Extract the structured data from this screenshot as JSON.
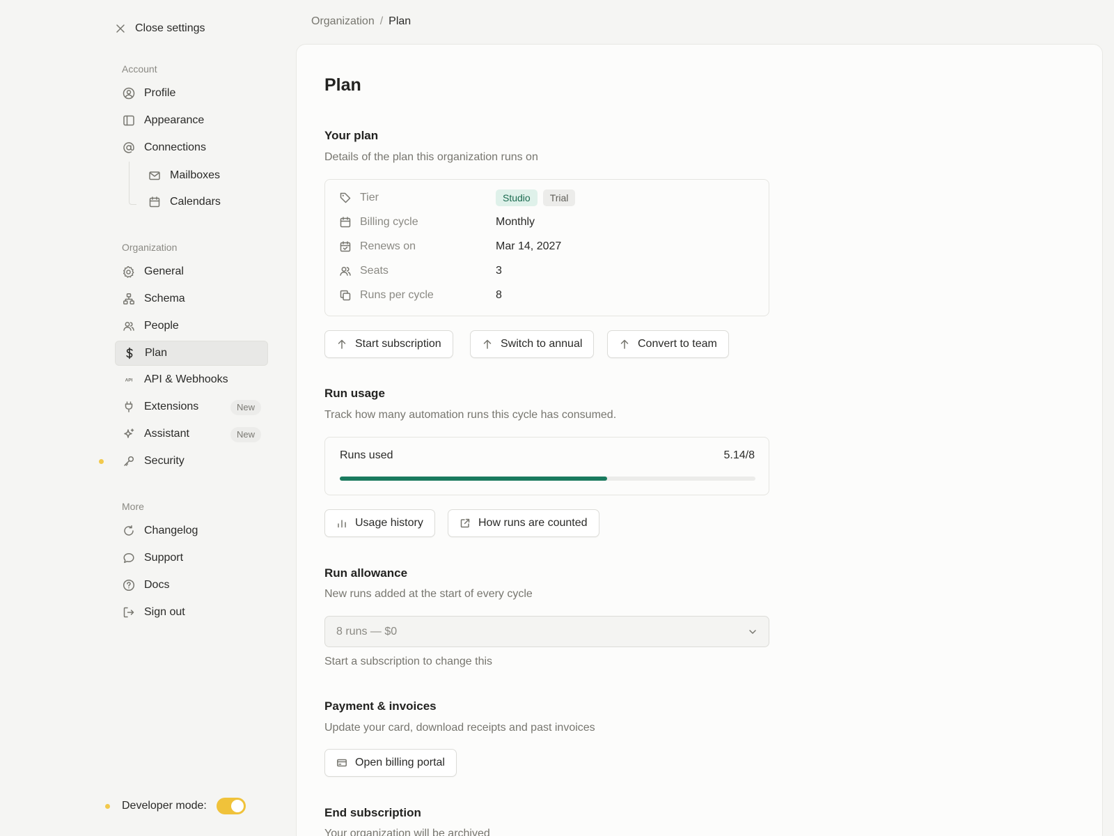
{
  "sidebar": {
    "close_label": "Close settings",
    "sections": {
      "account": "Account",
      "organization": "Organization",
      "more": "More"
    },
    "account_items": [
      {
        "label": "Profile",
        "icon": "user-circle-icon"
      },
      {
        "label": "Appearance",
        "icon": "layout-icon"
      },
      {
        "label": "Connections",
        "icon": "at-sign-icon"
      },
      {
        "label": "Mailboxes",
        "icon": "mail-icon"
      },
      {
        "label": "Calendars",
        "icon": "calendar-icon"
      }
    ],
    "org_items": [
      {
        "label": "General",
        "icon": "gear-icon"
      },
      {
        "label": "Schema",
        "icon": "schema-icon"
      },
      {
        "label": "People",
        "icon": "users-icon"
      },
      {
        "label": "Plan",
        "icon": "dollar-icon",
        "active": true
      },
      {
        "label": "API & Webhooks",
        "icon": "api-icon"
      },
      {
        "label": "Extensions",
        "icon": "plug-icon",
        "badge": "New"
      },
      {
        "label": "Assistant",
        "icon": "sparkle-icon",
        "badge": "New"
      },
      {
        "label": "Security",
        "icon": "key-icon"
      }
    ],
    "more_items": [
      {
        "label": "Changelog",
        "icon": "refresh-icon"
      },
      {
        "label": "Support",
        "icon": "chat-icon"
      },
      {
        "label": "Docs",
        "icon": "help-circle-icon"
      },
      {
        "label": "Sign out",
        "icon": "logout-icon"
      }
    ],
    "developer_mode_label": "Developer mode:",
    "developer_mode_on": true,
    "accent_color": "#f0c23a"
  },
  "breadcrumb": {
    "parent": "Organization",
    "separator": "/",
    "current": "Plan"
  },
  "main": {
    "title": "Plan",
    "your_plan": {
      "heading": "Your plan",
      "description": "Details of the plan this organization runs on",
      "rows": [
        {
          "label": "Tier",
          "icon": "tag-icon",
          "tags": [
            "Studio",
            "Trial"
          ]
        },
        {
          "label": "Billing cycle",
          "icon": "calendar-icon",
          "value": "Monthly"
        },
        {
          "label": "Renews on",
          "icon": "calendar-check-icon",
          "value": "Mar 14, 2027"
        },
        {
          "label": "Seats",
          "icon": "users-icon",
          "value": "3"
        },
        {
          "label": "Runs per cycle",
          "icon": "copy-icon",
          "value": "8"
        }
      ],
      "buttons": [
        "Start subscription",
        "Switch to annual",
        "Convert to team"
      ]
    },
    "run_usage": {
      "heading": "Run usage",
      "description": "Track how many automation runs this cycle has consumed.",
      "label": "Runs used",
      "value_text": "5.14/8",
      "progress_fraction": 0.6425,
      "progress_color": "#1a7a5e",
      "buttons": [
        "Usage history",
        "How runs are counted"
      ]
    },
    "run_allowance": {
      "heading": "Run allowance",
      "description": "New runs added at the start of every cycle",
      "select_value": "8 runs — $0",
      "hint": "Start a subscription to change this"
    },
    "payment": {
      "heading": "Payment & invoices",
      "description": "Update your card, download receipts and past invoices",
      "button": "Open billing portal"
    },
    "end_subscription": {
      "heading": "End subscription",
      "description": "Your organization will be archived"
    }
  }
}
